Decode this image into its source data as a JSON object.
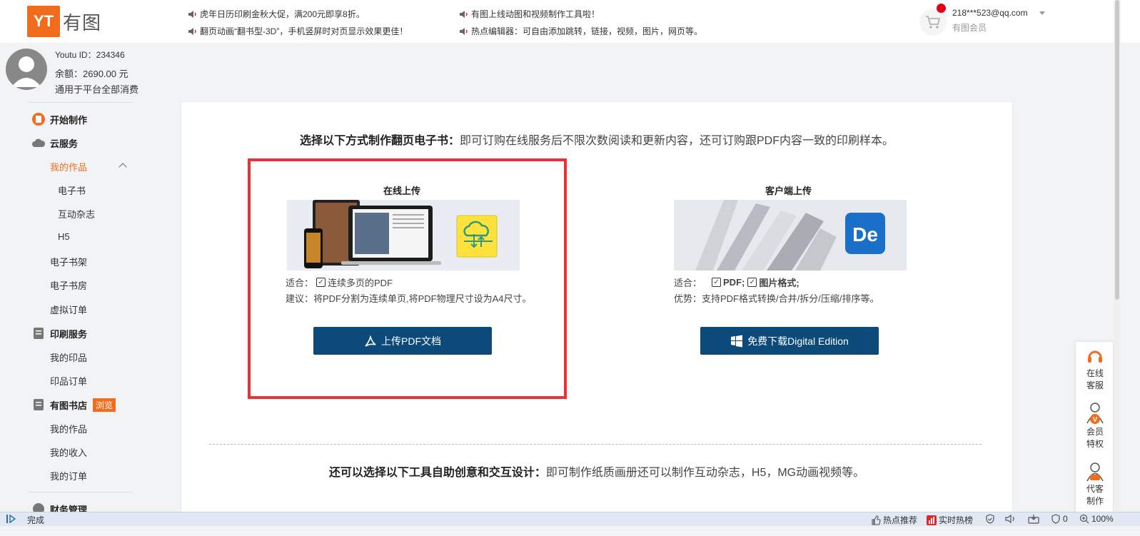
{
  "header": {
    "logo_mark": "YT",
    "logo_text": "有图",
    "notices": [
      "虎年日历印刷金秋大促，满200元即享8折。",
      "翻页动画“翻书型-3D”，手机竖屏时对页显示效果更佳！",
      "有图上线动图和视频制作工具啦！",
      "热点编辑器：可自由添加跳转，链接，视频，图片，网页等。"
    ],
    "user_email": "218***523@qq.com",
    "user_level": "有图会员"
  },
  "profile": {
    "id": "Youtu ID：234346",
    "balance": "余额：2690.00 元",
    "note": "通用于平台全部消费"
  },
  "sidebar": {
    "start": "开始制作",
    "cloud": "云服务",
    "my_works": "我的作品",
    "ebook": "电子书",
    "magazine": "互动杂志",
    "h5": "H5",
    "shelf": "电子书架",
    "room": "电子书房",
    "virtual_orders": "虚拟订单",
    "print": "印刷服务",
    "my_prints": "我的印品",
    "print_orders": "印品订单",
    "store": "有图书店",
    "store_badge": "浏览",
    "store_works": "我的作品",
    "store_income": "我的收入",
    "store_orders": "我的订单",
    "finance": "财务管理"
  },
  "main": {
    "heading_bold": "选择以下方式制作翻页电子书：",
    "heading_rest": "即可订购在线服务后不限次数阅读和更新内容，还可订购跟PDF内容一致的印刷样本。",
    "online": {
      "title": "在线上传",
      "fit_label": "适合：",
      "fit_item": "连续多页的PDF",
      "advice": "建议：将PDF分割为连续单页,将PDF物理尺寸设为A4尺寸。",
      "button": "上传PDF文档"
    },
    "client": {
      "title": "客户端上传",
      "fit_label": "适合：",
      "fit_item1": "PDF;",
      "fit_item2": "图片格式;",
      "advantage": "优势：支持PDF格式转换/合并/拆分/压缩/排序等。",
      "button": "免费下载Digital Edition",
      "app_badge": "De"
    },
    "heading2_bold": "还可以选择以下工具自助创意和交互设计：",
    "heading2_rest": "即可制作纸质画册还可以制作互动杂志，H5，MG动画视频等。"
  },
  "float_panel": {
    "service": [
      "在线",
      "客服"
    ],
    "vip": [
      "会员",
      "特权"
    ],
    "agent": [
      "代客",
      "制作"
    ]
  },
  "statusbar": {
    "done": "完成",
    "hot": "热点推荐",
    "realtime": "实时热榜",
    "count": "0",
    "zoom": "100%"
  },
  "colors": {
    "brand": "#f26c1d",
    "button": "#0b4a79",
    "highlight": "#ec3136"
  }
}
